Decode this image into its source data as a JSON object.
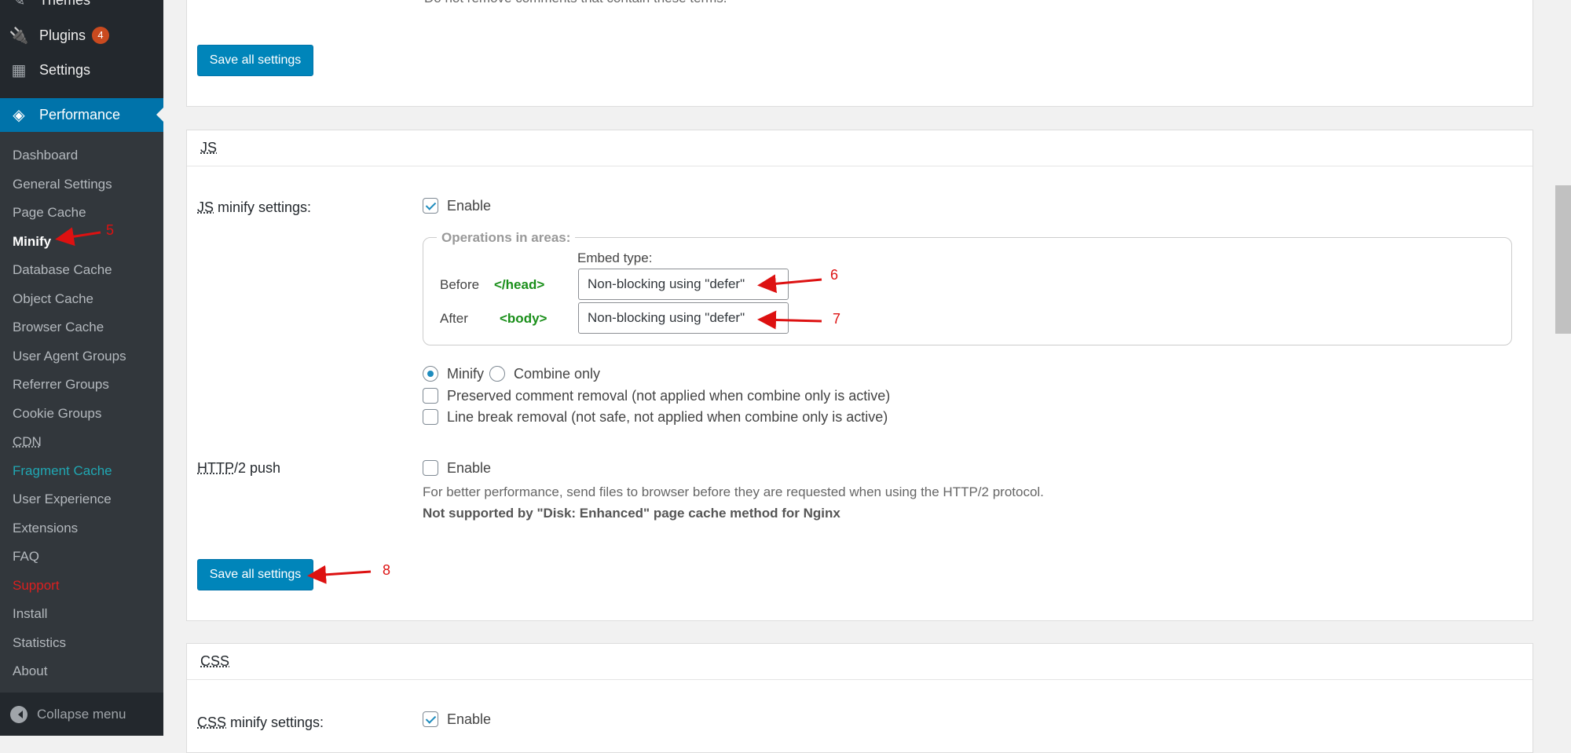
{
  "sidebar": {
    "menu": [
      {
        "label": "Themes",
        "icon": "brush-icon"
      },
      {
        "label": "Plugins",
        "icon": "plugin-icon",
        "badge": "4"
      },
      {
        "label": "Settings",
        "icon": "settings-icon"
      }
    ],
    "active": {
      "label": "Performance",
      "icon": "w3tc-cube-icon"
    },
    "submenu": [
      "Dashboard",
      "General Settings",
      "Page Cache",
      "Minify",
      "Database Cache",
      "Object Cache",
      "Browser Cache",
      "User Agent Groups",
      "Referrer Groups",
      "Cookie Groups",
      "CDN",
      "Fragment Cache",
      "User Experience",
      "Extensions",
      "FAQ",
      "Support",
      "Install",
      "Statistics",
      "About"
    ],
    "current": "Minify",
    "collapse": "Collapse menu"
  },
  "top_card": {
    "cut_text": "Do not remove comments that contain these terms.",
    "save": "Save all settings"
  },
  "js": {
    "title": "JS",
    "minify_label": "JS minify settings:",
    "enable": "Enable",
    "legend": "Operations in areas:",
    "embed_type": "Embed type:",
    "before": "Before",
    "before_tag": "</head>",
    "before_value": "Non-blocking using \"defer\"",
    "after": "After",
    "after_tag": "<body>",
    "after_value": "Non-blocking using \"defer\"",
    "minify": "Minify",
    "combine": "Combine only",
    "preserved": "Preserved comment removal (not applied when combine only is active)",
    "linebreak": "Line break removal (not safe, not applied when combine only is active)",
    "http2_label": "HTTP/2 push",
    "http2_enable": "Enable",
    "http2_desc": "For better performance, send files to browser before they are requested when using the HTTP/2 protocol.",
    "http2_note": "Not supported by \"Disk: Enhanced\" page cache method for Nginx",
    "save": "Save all settings"
  },
  "css": {
    "title": "CSS",
    "minify_label": "CSS minify settings:",
    "enable": "Enable"
  },
  "annotations": [
    "5",
    "6",
    "7",
    "8"
  ],
  "colors": {
    "accent": "#0073aa",
    "button": "#0085ba",
    "annotation": "#dd1111",
    "tag": "#1a8f1a"
  }
}
